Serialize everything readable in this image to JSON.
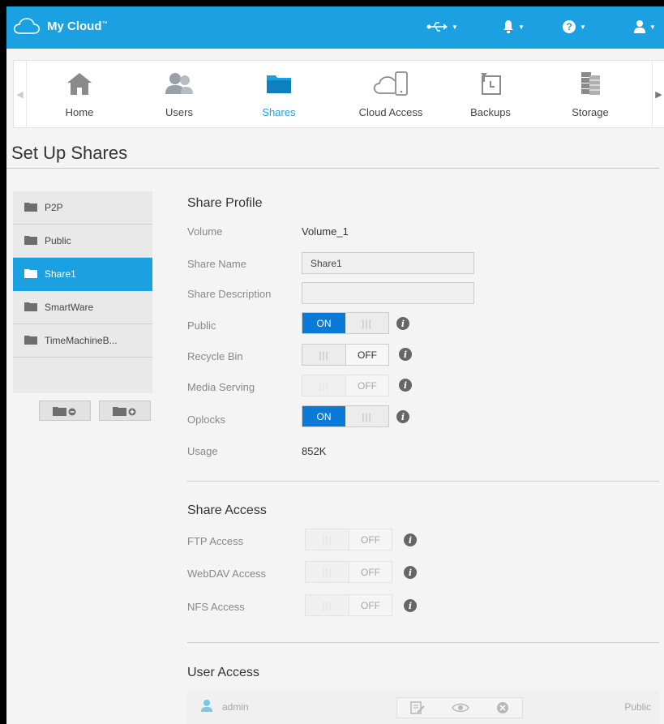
{
  "header": {
    "app_name": "My Cloud",
    "trademark": "™",
    "icons": [
      "usb-icon",
      "bell-icon",
      "help-icon",
      "user-icon"
    ],
    "accent": "#1ba1e2"
  },
  "nav": {
    "items": [
      {
        "label": "Home",
        "icon": "home-icon"
      },
      {
        "label": "Users",
        "icon": "users-icon"
      },
      {
        "label": "Shares",
        "icon": "shares-icon",
        "active": true
      },
      {
        "label": "Cloud Access",
        "icon": "cloud-access-icon"
      },
      {
        "label": "Backups",
        "icon": "backups-icon"
      },
      {
        "label": "Storage",
        "icon": "storage-icon"
      }
    ]
  },
  "page_title": "Set Up Shares",
  "shares": {
    "items": [
      "P2P",
      "Public",
      "Share1",
      "SmartWare",
      "TimeMachineB..."
    ],
    "selected": "Share1"
  },
  "share_profile": {
    "title": "Share Profile",
    "volume_label": "Volume",
    "volume_value": "Volume_1",
    "share_name_label": "Share Name",
    "share_name_value": "Share1",
    "share_description_label": "Share Description",
    "share_description_value": "",
    "public_label": "Public",
    "public_state": "ON",
    "recycle_bin_label": "Recycle Bin",
    "recycle_bin_state": "OFF",
    "media_serving_label": "Media Serving",
    "media_serving_state": "OFF",
    "oplocks_label": "Oplocks",
    "oplocks_state": "ON",
    "usage_label": "Usage",
    "usage_value": "852K"
  },
  "share_access": {
    "title": "Share Access",
    "ftp_label": "FTP Access",
    "ftp_state": "OFF",
    "webdav_label": "WebDAV Access",
    "webdav_state": "OFF",
    "nfs_label": "NFS Access",
    "nfs_state": "OFF"
  },
  "user_access": {
    "title": "User Access",
    "users": [
      {
        "name": "admin",
        "permission": "Public"
      }
    ]
  },
  "toggle_grip": "|||"
}
